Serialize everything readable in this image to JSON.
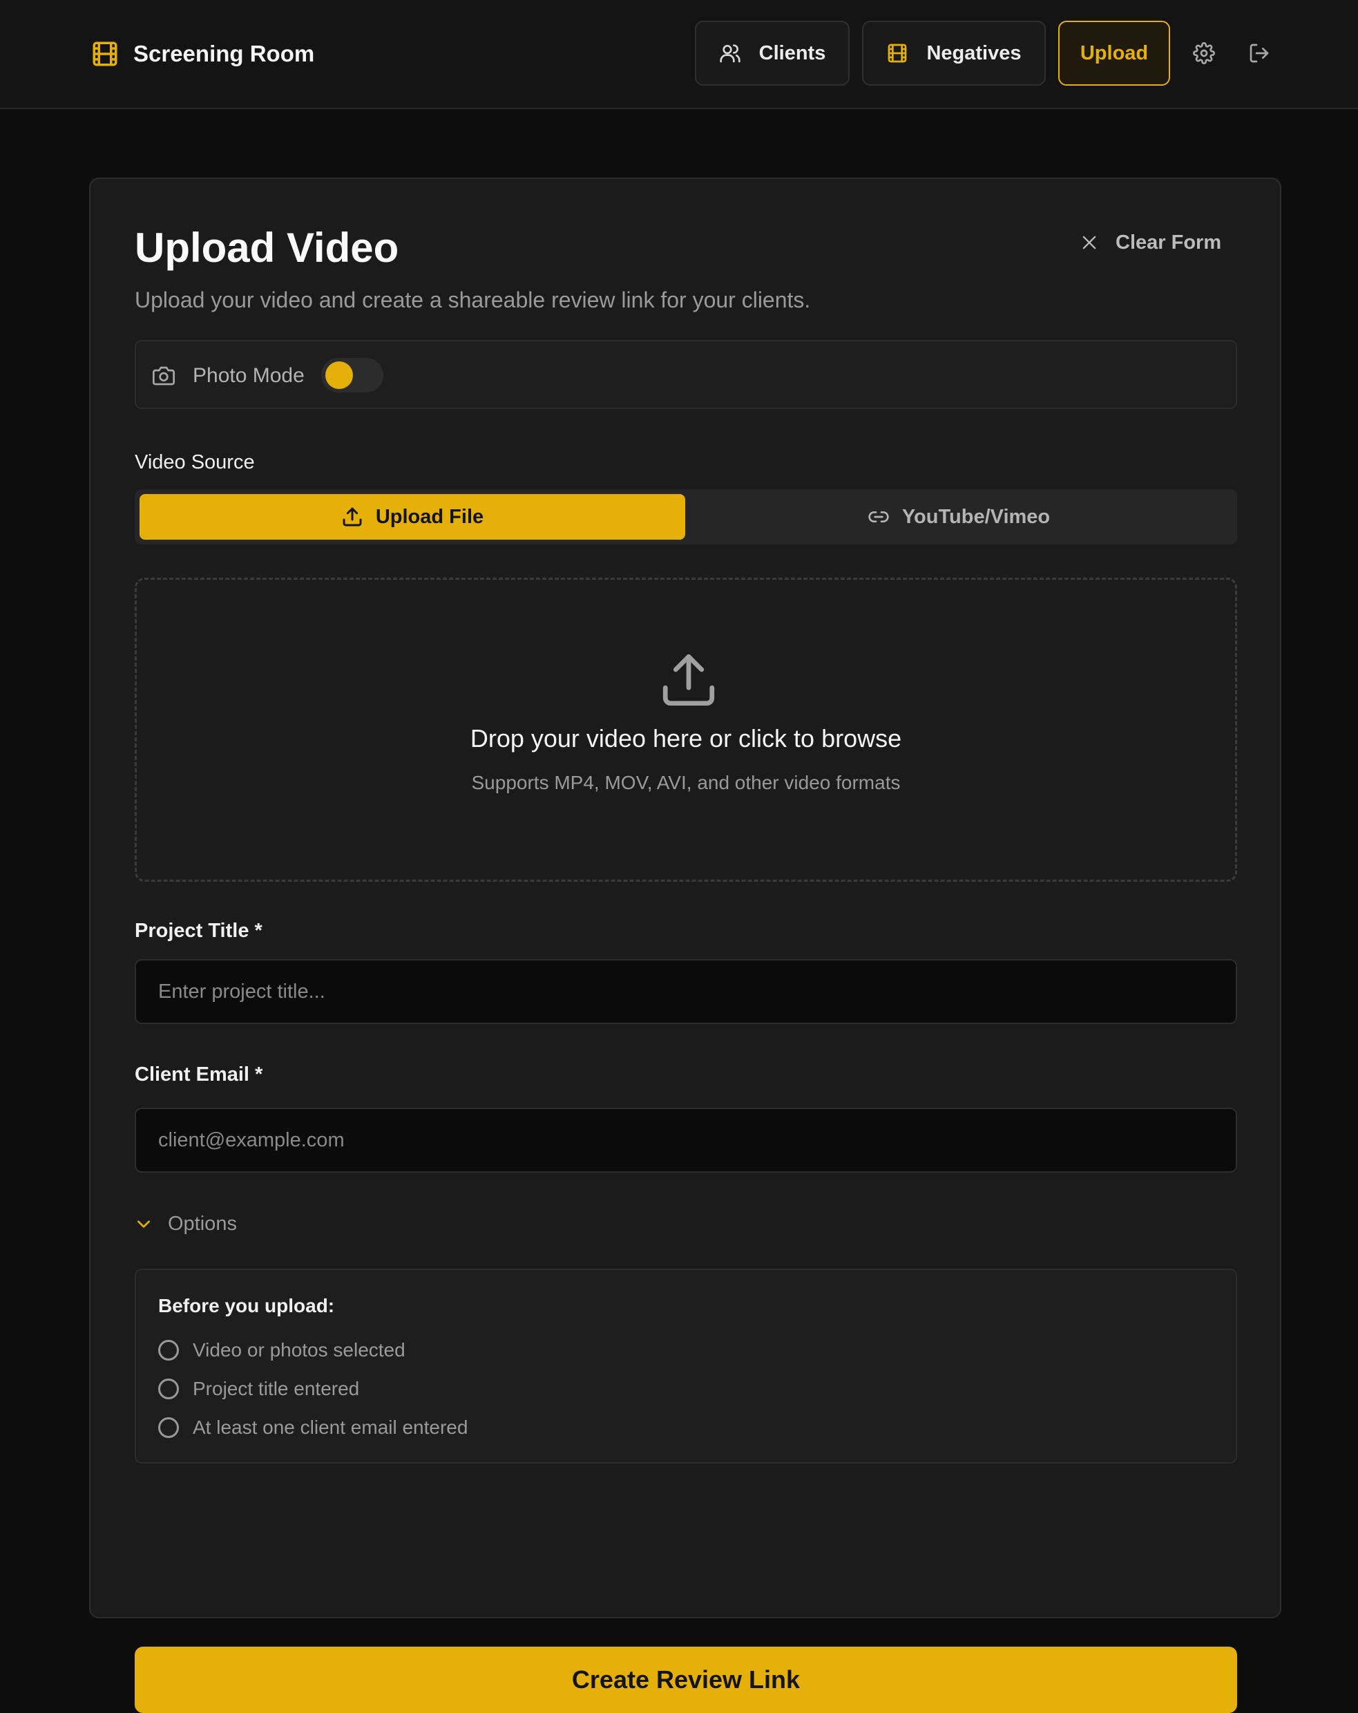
{
  "app": {
    "name": "Screening Room"
  },
  "nav": {
    "clients": "Clients",
    "negatives": "Negatives",
    "upload": "Upload"
  },
  "page": {
    "title": "Upload Video",
    "subtitle": "Upload your video and create a shareable review link for your clients.",
    "clear_form": "Clear Form"
  },
  "photo_mode": {
    "label": "Photo Mode",
    "enabled": false
  },
  "video_source": {
    "label": "Video Source",
    "upload_file": "Upload File",
    "youtube_vimeo": "YouTube/Vimeo",
    "selected": "Upload File"
  },
  "dropzone": {
    "title": "Drop your video here or click to browse",
    "subtitle": "Supports MP4, MOV, AVI, and other video formats"
  },
  "form": {
    "project_title_label": "Project Title *",
    "project_title_placeholder": "Enter project title...",
    "project_title_value": "",
    "client_email_label": "Client Email *",
    "client_email_placeholder": "client@example.com",
    "client_email_value": "",
    "options_label": "Options"
  },
  "checklist": {
    "title": "Before you upload:",
    "items": [
      "Video or photos selected",
      "Project title entered",
      "At least one client email entered"
    ]
  },
  "cta": {
    "label": "Create Review Link"
  },
  "colors": {
    "accent": "#e6b00a",
    "background": "#0d0d0d",
    "card": "#1b1b1b"
  }
}
